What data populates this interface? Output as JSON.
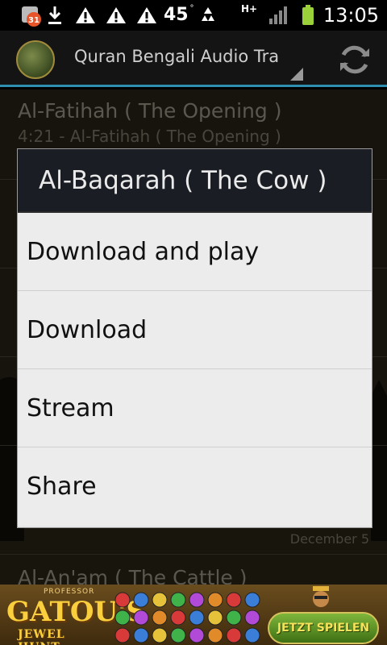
{
  "status_bar": {
    "notification_count": "31",
    "battery_level_text": "45",
    "network_type": "H+",
    "time": "13:05"
  },
  "action_bar": {
    "title": "Quran Bengali Audio Tra",
    "refresh_icon": "refresh-icon",
    "logo_icon": "quran-logo"
  },
  "tracks": [
    {
      "title": "Al-Fatihah ( The Opening )",
      "subtitle": "4:21 - Al-Fatihah ( The Opening )"
    },
    {
      "title": "",
      "date": "December 5"
    },
    {
      "title": "Al-An'am ( The Cattle )"
    }
  ],
  "dialog": {
    "title": "Al-Baqarah ( The Cow )",
    "options": [
      "Download and play",
      "Download",
      "Stream",
      "Share"
    ]
  },
  "ad": {
    "professor": "PROFESSOR",
    "brand": "GATOU'S",
    "sub": "JEWEL HUNT",
    "cta": "JETZT SPIELEN"
  },
  "colors": {
    "accent_line": "#2f8fb0",
    "dialog_header_bg": "#1a1e24",
    "dialog_body_bg": "#ececec",
    "list_bg": "#2a2619"
  }
}
